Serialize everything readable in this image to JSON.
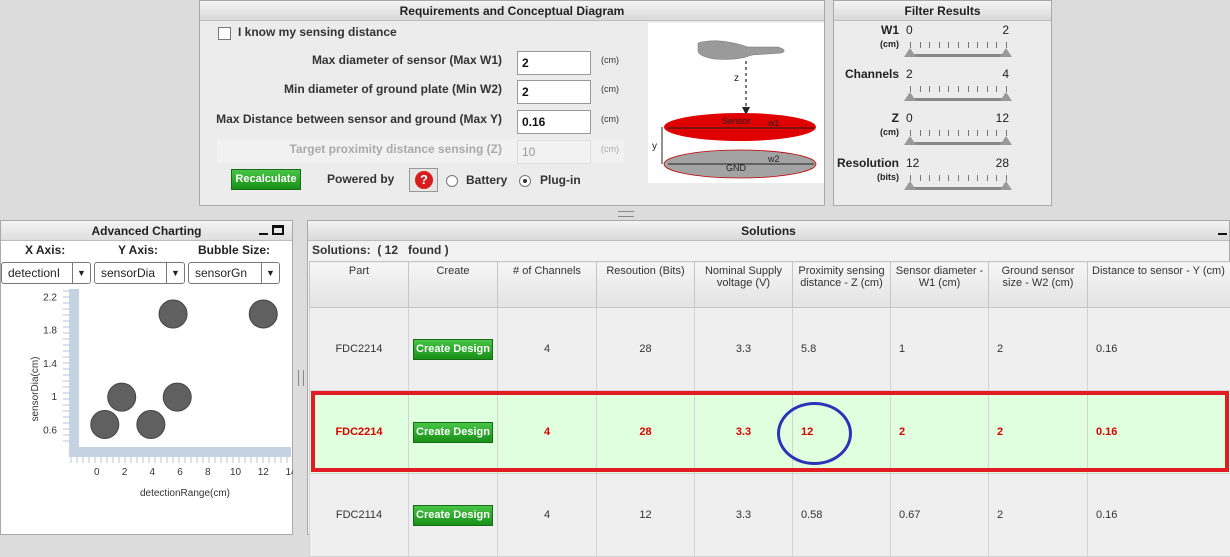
{
  "requirements": {
    "title": "Requirements and Conceptual Diagram",
    "know_distance_label": "I know my sensing distance",
    "know_distance_checked": false,
    "fields": [
      {
        "label": "Max diameter of sensor (Max W1)",
        "value": "2",
        "unit": "(cm)",
        "enabled": true
      },
      {
        "label": "Min diameter of ground plate (Min W2)",
        "value": "2",
        "unit": "(cm)",
        "enabled": true
      },
      {
        "label": "Max Distance between sensor and ground (Max Y)",
        "value": "0.16",
        "unit": "(cm)",
        "enabled": true
      },
      {
        "label": "Target proximity distance sensing (Z)",
        "value": "10",
        "unit": "(cm)",
        "enabled": false
      }
    ],
    "recalculate_label": "Recalculate",
    "powered_by_label": "Powered by",
    "help_glyph": "?",
    "power_options": [
      {
        "label": "Battery",
        "selected": false
      },
      {
        "label": "Plug-in",
        "selected": true
      }
    ],
    "diagram": {
      "z": "z",
      "y": "y",
      "sensor": "Sensor",
      "w1": "w1",
      "gnd": "GND",
      "w2": "w2"
    }
  },
  "filter": {
    "title": "Filter Results",
    "sliders": [
      {
        "name": "W1",
        "unit": "(cm)",
        "min": "0",
        "max": "2"
      },
      {
        "name": "Channels",
        "unit": "",
        "min": "2",
        "max": "4"
      },
      {
        "name": "Z",
        "unit": "(cm)",
        "min": "0",
        "max": "12"
      },
      {
        "name": "Resolution",
        "unit": "(bits)",
        "min": "12",
        "max": "28"
      }
    ]
  },
  "charting": {
    "title": "Advanced Charting",
    "x_axis_label": "X Axis:",
    "y_axis_label": "Y Axis:",
    "bubble_label": "Bubble Size:",
    "x_select": "detectionI",
    "y_select": "sensorDia",
    "bubble_select": "sensorGn",
    "arrow_glyph": "▼"
  },
  "chart_data": {
    "type": "scatter",
    "xlabel": "detectionRange(cm)",
    "ylabel": "sensorDia(cm)",
    "xlim": [
      -2,
      14
    ],
    "ylim": [
      0.4,
      2.3
    ],
    "xticks": [
      "0",
      "2",
      "4",
      "6",
      "8",
      "10",
      "12",
      "14"
    ],
    "yticks": [
      "0.6",
      "1",
      "1.4",
      "1.8",
      "2.2"
    ],
    "ytick_values": [
      0.6,
      1,
      1.4,
      1.8,
      2.2
    ],
    "points": [
      {
        "x": 0.58,
        "y": 0.67
      },
      {
        "x": 1.8,
        "y": 1.0
      },
      {
        "x": 3.9,
        "y": 0.67
      },
      {
        "x": 5.8,
        "y": 1.0
      },
      {
        "x": 5.5,
        "y": 2.0
      },
      {
        "x": 12.0,
        "y": 2.0
      }
    ],
    "grid": false,
    "point_color": "#606060"
  },
  "solutions": {
    "title": "Solutions",
    "summary": "Solutions:  ( 12   found )",
    "columns": [
      "Part",
      "Create",
      "# of Channels",
      "Resoution (Bits)",
      "Nominal Supply voltage (V)",
      "Proximity sensing distance - Z (cm)",
      "Sensor diameter - W1 (cm)",
      "Ground sensor size - W2 (cm)",
      "Distance to sensor - Y (cm)"
    ],
    "create_label": "Create Design",
    "rows": [
      {
        "part": "FDC2214",
        "channels": "4",
        "bits": "28",
        "voltage": "3.3",
        "z": "5.8",
        "w1": "1",
        "w2": "2",
        "y": "0.16",
        "highlight": false
      },
      {
        "part": "FDC2214",
        "channels": "4",
        "bits": "28",
        "voltage": "3.3",
        "z": "12",
        "w1": "2",
        "w2": "2",
        "y": "0.16",
        "highlight": true
      },
      {
        "part": "FDC2114",
        "channels": "4",
        "bits": "12",
        "voltage": "3.3",
        "z": "0.58",
        "w1": "0.67",
        "w2": "2",
        "y": "0.16",
        "highlight": false
      }
    ],
    "highlight_color": "#e31c24",
    "circle_color": "#2b34b8"
  }
}
